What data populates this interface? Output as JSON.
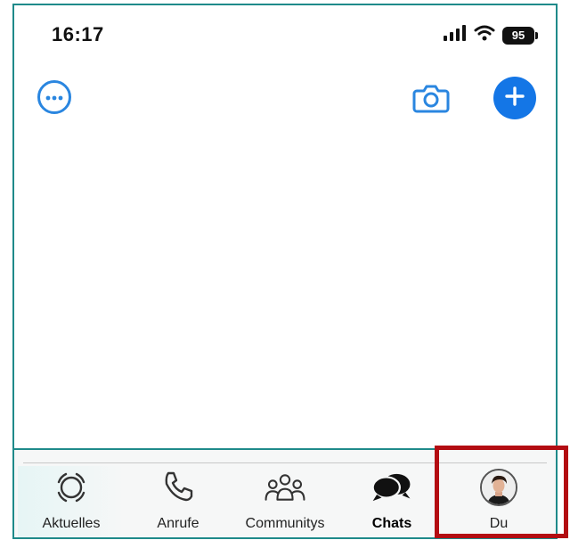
{
  "status_bar": {
    "time": "16:17",
    "battery_level": "95",
    "signal_icon": "cellular-signal-icon",
    "wifi_icon": "wifi-icon"
  },
  "top_bar": {
    "menu_icon": "more-options-icon",
    "camera_icon": "camera-icon",
    "new_chat_icon": "plus-icon",
    "accent_color": "#1476e6"
  },
  "tabs": [
    {
      "label": "Aktuelles",
      "icon": "status-icon",
      "active": false
    },
    {
      "label": "Anrufe",
      "icon": "phone-icon",
      "active": false
    },
    {
      "label": "Communitys",
      "icon": "communities-icon",
      "active": false
    },
    {
      "label": "Chats",
      "icon": "chat-bubbles-icon",
      "active": true
    },
    {
      "label": "Du",
      "icon": "avatar",
      "active": false
    }
  ],
  "highlight": {
    "target": "Du",
    "color": "#b30d12"
  }
}
